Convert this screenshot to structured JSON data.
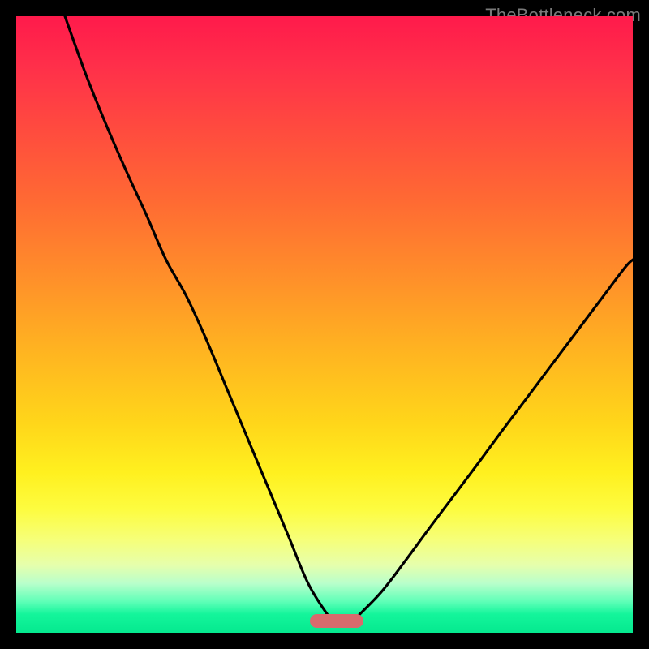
{
  "watermark": "TheBottleneck.com",
  "colors": {
    "frame_bg": "#000000",
    "curve_stroke": "#000000",
    "pill_fill": "#d86b6d",
    "gradient_top": "#ff1a4b",
    "gradient_bottom": "#05e98f"
  },
  "chart_data": {
    "type": "line",
    "title": "",
    "xlabel": "",
    "ylabel": "",
    "xlim": [
      0,
      100
    ],
    "ylim": [
      0,
      100
    ],
    "grid": false,
    "legend": false,
    "annotations": [
      {
        "type": "pill",
        "x": 52,
        "y": 2,
        "width_pct": 8.7,
        "color": "#d86b6d"
      }
    ],
    "series": [
      {
        "name": "left-curve",
        "x": [
          7.9,
          11.2,
          14.5,
          17.8,
          21.1,
          24.3,
          27.6,
          30.9,
          34.2,
          37.5,
          40.8,
          44.1,
          47.4,
          50.7
        ],
        "values": [
          100.0,
          90.8,
          82.6,
          75.0,
          67.8,
          60.5,
          54.6,
          47.4,
          39.5,
          31.6,
          23.7,
          15.8,
          7.9,
          2.6
        ]
      },
      {
        "name": "right-curve",
        "x": [
          55.3,
          59.2,
          63.2,
          67.1,
          71.1,
          75.0,
          78.9,
          82.9,
          86.8,
          90.8,
          94.7,
          98.7,
          100.0
        ],
        "values": [
          2.6,
          6.6,
          11.8,
          17.1,
          22.4,
          27.6,
          32.9,
          38.2,
          43.4,
          48.7,
          53.9,
          59.2,
          60.5
        ]
      }
    ]
  }
}
